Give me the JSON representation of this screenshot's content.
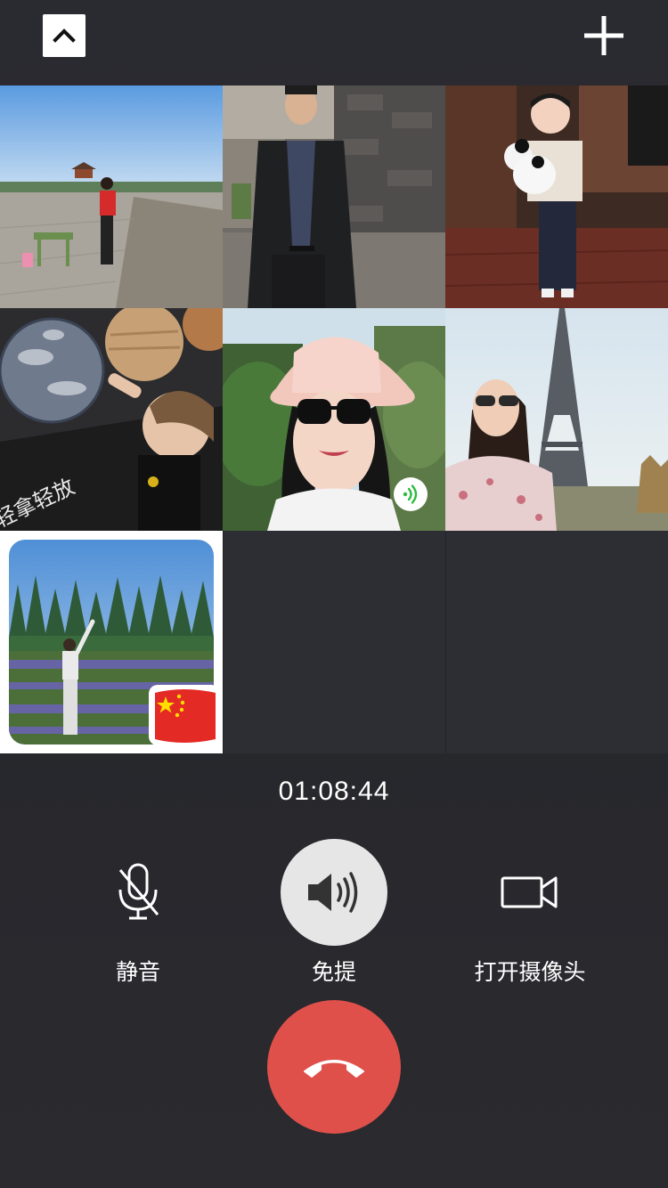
{
  "call": {
    "timer": "01:08:44",
    "participant_count": 7
  },
  "topbar": {
    "minimize_icon": "chevron-up-icon",
    "add_icon": "plus-icon"
  },
  "tiles": [
    {
      "name": "participant-1",
      "description_icon": "avatar"
    },
    {
      "name": "participant-2",
      "description_icon": "avatar"
    },
    {
      "name": "participant-3",
      "description_icon": "avatar"
    },
    {
      "name": "participant-4",
      "caption": "轻拿轻放",
      "description_icon": "avatar"
    },
    {
      "name": "participant-5",
      "speaking": true,
      "description_icon": "avatar"
    },
    {
      "name": "participant-6",
      "description_icon": "avatar"
    },
    {
      "name": "self",
      "badge_icon": "china-flag-icon"
    }
  ],
  "controls": {
    "mute": {
      "label": "静音",
      "icon": "microphone-icon",
      "active": false
    },
    "speaker": {
      "label": "免提",
      "icon": "speaker-icon",
      "active": true
    },
    "camera": {
      "label": "打开摄像头",
      "icon": "video-camera-icon",
      "active": false
    },
    "hangup": {
      "icon": "hang-up-icon"
    }
  },
  "colors": {
    "hangup": "#e0504b",
    "speaking_indicator": "#2dbb3f",
    "active_control": "#e6e6e6",
    "background": "#26262b"
  }
}
